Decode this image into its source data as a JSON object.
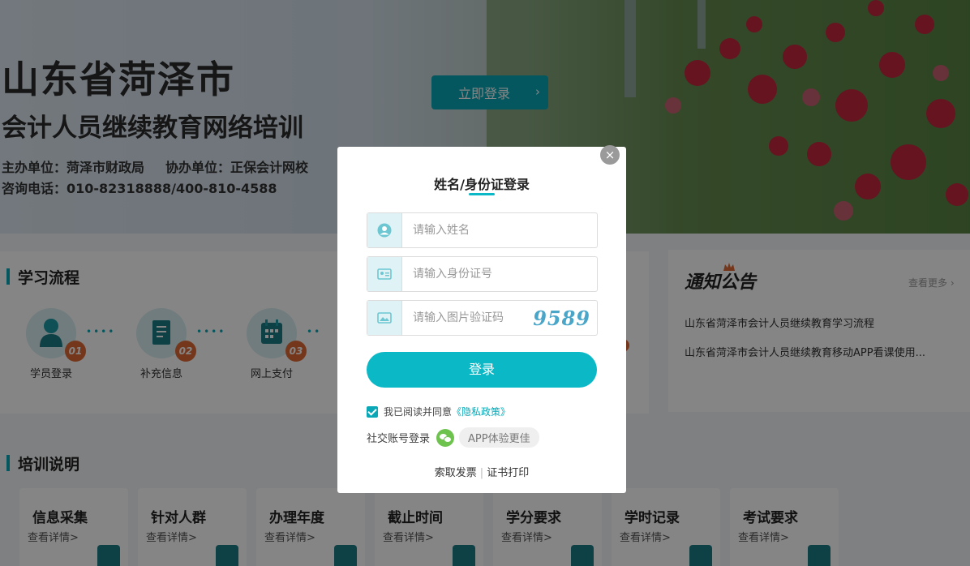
{
  "banner": {
    "title": "山东省菏泽市",
    "subtitle": "会计人员继续教育网络培训",
    "organizer": "主办单位：菏泽市财政局",
    "co_organizer": "协办单位：正保会计网校",
    "hotline": "咨询电话：010-82318888/400-810-4588",
    "login_now": "立即登录",
    "login_now_icon": "chevron-right-icon"
  },
  "flow": {
    "section_title": "学习流程",
    "steps": [
      {
        "num": "01",
        "label": "学员登录",
        "icon": "user-icon"
      },
      {
        "num": "02",
        "label": "补充信息",
        "icon": "document-icon"
      },
      {
        "num": "03",
        "label": "网上支付",
        "icon": "calendar-icon"
      }
    ]
  },
  "notice": {
    "title": "通知公告",
    "more": "查看更多 ›",
    "items": [
      "山东省菏泽市会计人员继续教育学习流程",
      "山东省菏泽市会计人员继续教育移动APP看课使用..."
    ]
  },
  "training": {
    "section_title": "培训说明",
    "detail_label": "查看详情>",
    "cards": [
      "信息采集",
      "针对人群",
      "办理年度",
      "截止时间",
      "学分要求",
      "学时记录",
      "考试要求"
    ]
  },
  "modal": {
    "close": "×",
    "title": "姓名/身份证登录",
    "name_placeholder": "请输入姓名",
    "id_placeholder": "请输入身份证号",
    "captcha_placeholder": "请输入图片验证码",
    "captcha_text": "9589",
    "login_button": "登录",
    "agree_text": "我已阅读并同意",
    "privacy_link": "《隐私政策》",
    "social_label": "社交账号登录",
    "app_label": "APP体验更佳",
    "invoice_link": "索取发票",
    "certificate_link": "证书打印",
    "accent_color": "#0ab8c6"
  }
}
